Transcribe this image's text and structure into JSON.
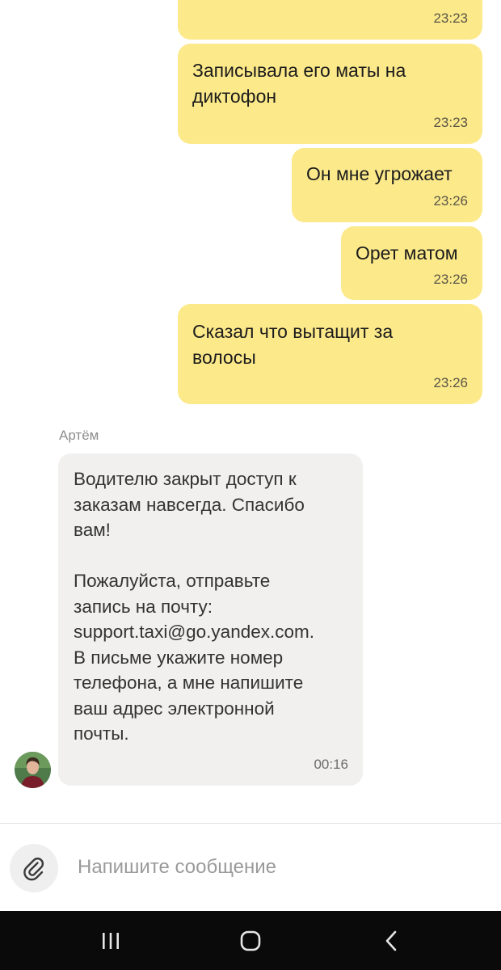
{
  "messages_out": [
    {
      "text": "",
      "time": "23:23"
    },
    {
      "text": "Записывала его маты на\nдиктофон",
      "time": "23:23"
    },
    {
      "text": "Он мне угрожает",
      "time": "23:26"
    },
    {
      "text": "Орет матом",
      "time": "23:26"
    },
    {
      "text": "Сказал что вытащит за\nволосы",
      "time": "23:26"
    }
  ],
  "message_in": {
    "sender": "Артём",
    "text": "Водителю закрыт доступ к\nзаказам навсегда. Спасибо\nвам!\n\nПожалуйста, отправьте\nзапись на почту:\nsupport.taxi@go.yandex.com.\nВ письме укажите номер\nтелефона, а мне напишите\nваш адрес электронной\nпочты.",
    "time": "00:16"
  },
  "composer": {
    "placeholder": "Напишите сообщение",
    "value": "",
    "attach_icon": "paperclip-icon"
  },
  "navbar": {
    "icons": [
      "recent-apps-icon",
      "home-icon",
      "back-icon"
    ]
  },
  "colors": {
    "outgoing_bubble": "#fce98a",
    "incoming_bubble": "#f1f0ef",
    "navbar": "#0a0a0a"
  }
}
